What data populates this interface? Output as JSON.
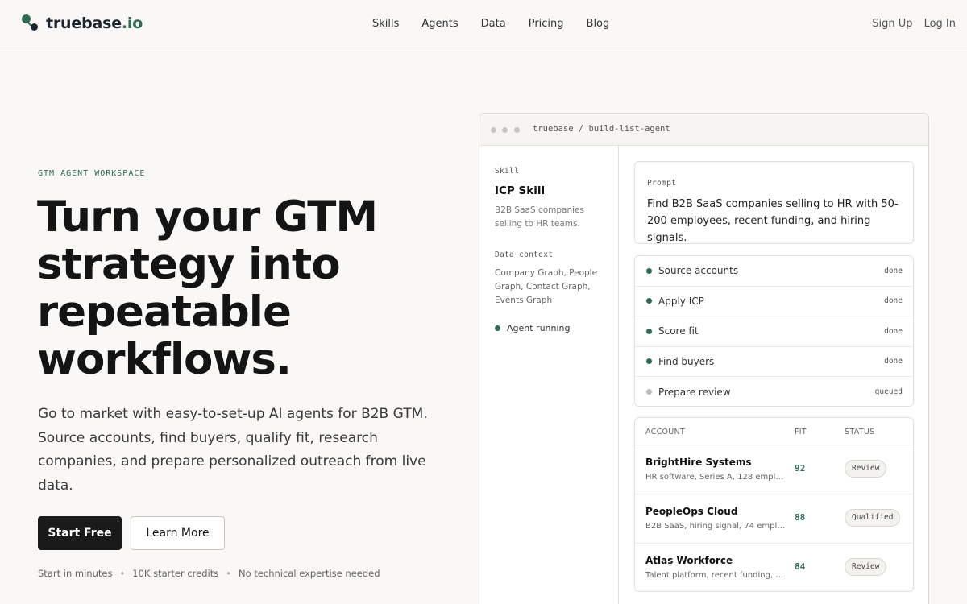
{
  "brand": {
    "name": "truebase",
    "tld": ".io"
  },
  "nav": {
    "links": [
      "Skills",
      "Agents",
      "Data",
      "Pricing",
      "Blog"
    ],
    "signup": "Sign Up",
    "login": "Log In"
  },
  "hero": {
    "eyebrow": "GTM AGENT WORKSPACE",
    "headline": "Turn your GTM strategy into repeatable workflows.",
    "subtext": "Go to market with easy-to-set-up AI agents for B2B GTM. Source accounts, find buyers, qualify fit, research companies, and prepare personalized outreach from live data.",
    "cta_primary": "Start Free",
    "cta_secondary": "Learn More",
    "facts": [
      "Start in minutes",
      "10K starter credits",
      "No technical expertise needed"
    ]
  },
  "panel": {
    "path": "truebase / build-list-agent",
    "side": {
      "skill_label": "Skill",
      "skill_name": "ICP Skill",
      "skill_desc": "B2B SaaS companies selling to HR teams.",
      "context_label": "Data context",
      "context": "Company Graph, People Graph, Contact Graph, Events Graph",
      "status": "Agent running"
    },
    "prompt": {
      "label": "Prompt",
      "text": "Find B2B SaaS companies selling to HR with 50-200 employees, recent funding, and hiring signals."
    },
    "steps": [
      {
        "name": "Source accounts",
        "status": "done"
      },
      {
        "name": "Apply ICP",
        "status": "done"
      },
      {
        "name": "Score fit",
        "status": "done"
      },
      {
        "name": "Find buyers",
        "status": "done"
      },
      {
        "name": "Prepare review",
        "status": "queued"
      }
    ],
    "accounts": {
      "headers": [
        "ACCOUNT",
        "FIT",
        "STATUS"
      ],
      "rows": [
        {
          "name": "BrightHire Systems",
          "desc": "HR software, Series A, 128 emplo...",
          "fit": "92",
          "status": "Review"
        },
        {
          "name": "PeopleOps Cloud",
          "desc": "B2B SaaS, hiring signal, 74 emplo...",
          "fit": "88",
          "status": "Qualified"
        },
        {
          "name": "Atlas Workforce",
          "desc": "Talent platform, recent funding, 1...",
          "fit": "84",
          "status": "Review"
        }
      ]
    }
  },
  "colors": {
    "accent": "#2f6b54",
    "dark": "#1a1a1a",
    "background": "#f9f8f6"
  }
}
